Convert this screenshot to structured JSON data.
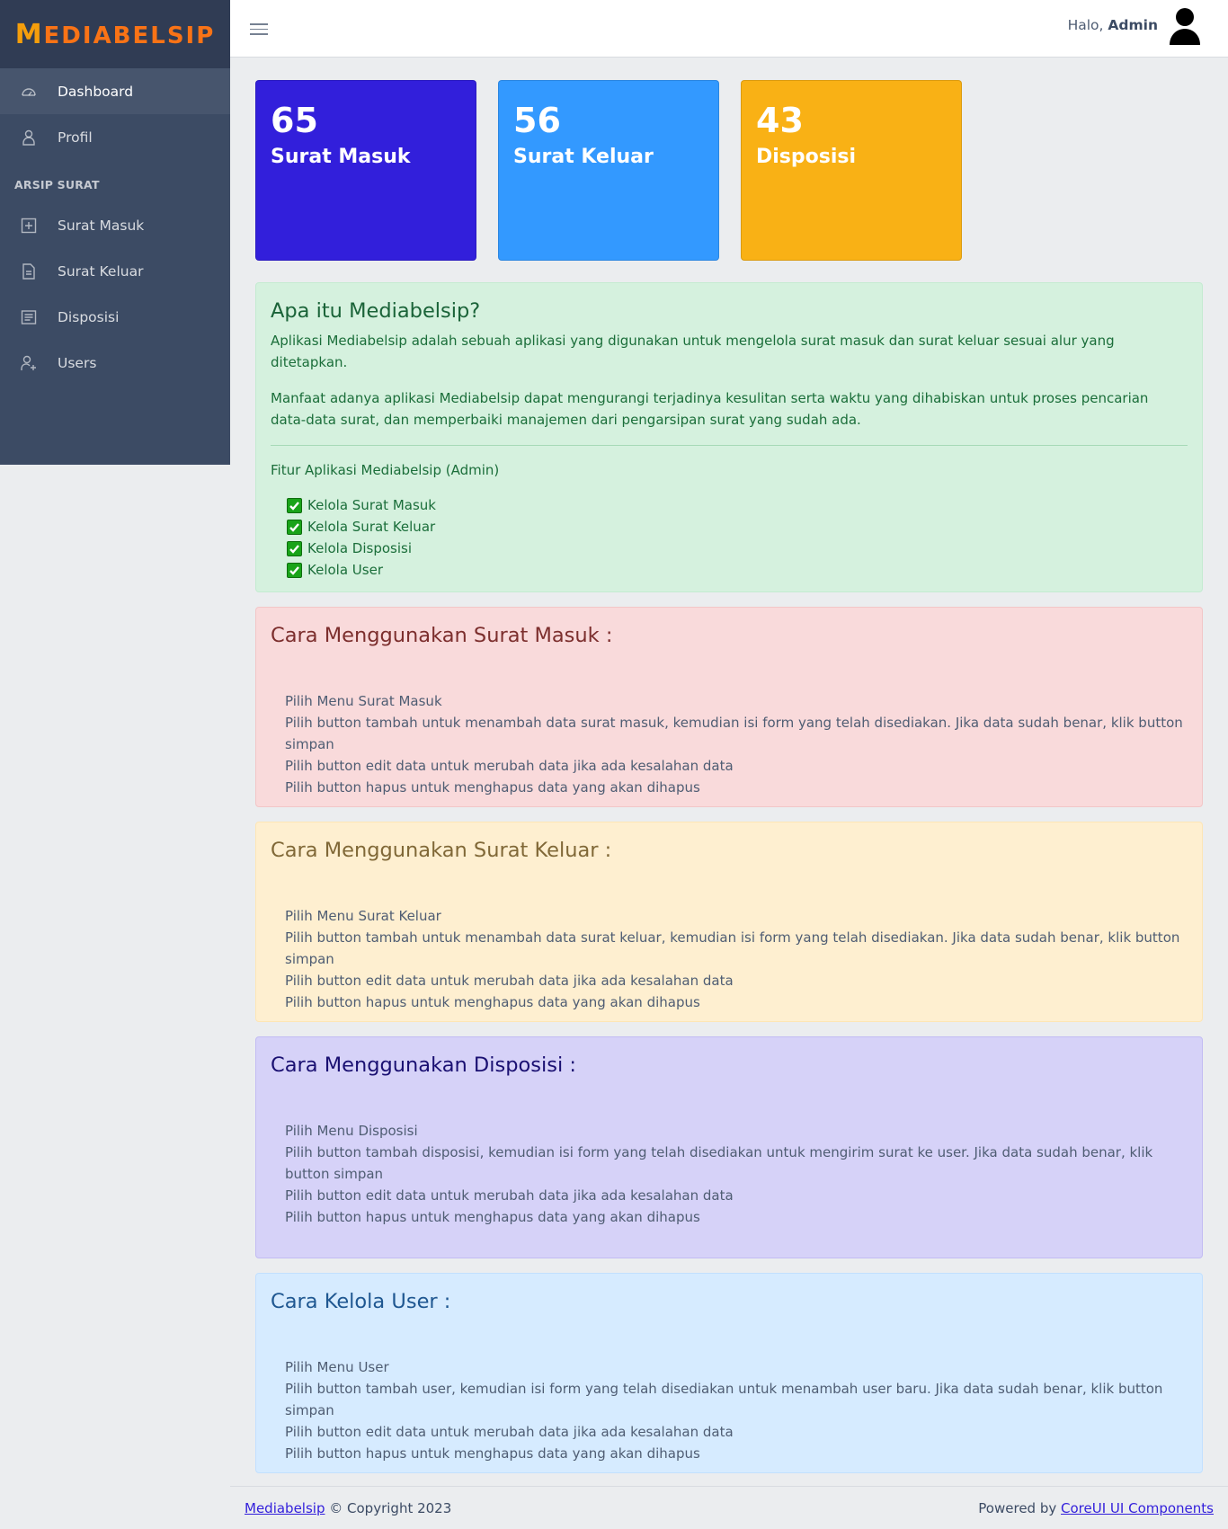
{
  "brand": {
    "logo_m": "M",
    "logo_rest": "EDIABELSIP"
  },
  "sidebar": {
    "items": [
      {
        "label": "Dashboard",
        "icon": "speedometer-icon"
      },
      {
        "label": "Profil",
        "icon": "user-icon"
      }
    ],
    "section_title": "ARSIP SURAT",
    "archive_items": [
      {
        "label": "Surat Masuk",
        "icon": "note-add-icon"
      },
      {
        "label": "Surat Keluar",
        "icon": "file-icon"
      },
      {
        "label": "Disposisi",
        "icon": "notes-icon"
      },
      {
        "label": "Users",
        "icon": "user-plus-icon"
      }
    ]
  },
  "header": {
    "greeting": "Halo,",
    "user": "Admin"
  },
  "stats": [
    {
      "value": "65",
      "label": "Surat Masuk",
      "color": "#321fdb"
    },
    {
      "value": "56",
      "label": "Surat Keluar",
      "color": "#3399ff"
    },
    {
      "value": "43",
      "label": "Disposisi",
      "color": "#f9b115"
    }
  ],
  "about": {
    "title": "Apa itu Mediabelsip?",
    "p1": "Aplikasi Mediabelsip adalah sebuah aplikasi yang digunakan untuk mengelola surat masuk dan surat keluar sesuai alur yang ditetapkan.",
    "p2": "Manfaat adanya aplikasi Mediabelsip dapat mengurangi terjadinya kesulitan serta waktu yang dihabiskan untuk proses pencarian data-data surat, dan memperbaiki manajemen dari pengarsipan surat yang sudah ada.",
    "features_title": "Fitur Aplikasi Mediabelsip (Admin)",
    "features": [
      "Kelola Surat Masuk",
      "Kelola Surat Keluar",
      "Kelola Disposisi",
      "Kelola User"
    ]
  },
  "guides": {
    "surat_masuk": {
      "title": "Cara Menggunakan Surat Masuk :",
      "steps": [
        "Pilih Menu Surat Masuk",
        "Pilih button tambah untuk menambah data surat masuk, kemudian isi form yang telah disediakan. Jika data sudah benar, klik button simpan",
        "Pilih button edit data untuk merubah data jika ada kesalahan data",
        "Pilih button hapus untuk menghapus data yang akan dihapus"
      ]
    },
    "surat_keluar": {
      "title": "Cara Menggunakan Surat Keluar :",
      "steps": [
        "Pilih Menu Surat Keluar",
        "Pilih button tambah untuk menambah data surat keluar, kemudian isi form yang telah disediakan. Jika data sudah benar, klik button simpan",
        "Pilih button edit data untuk merubah data jika ada kesalahan data",
        "Pilih button hapus untuk menghapus data yang akan dihapus"
      ]
    },
    "disposisi": {
      "title": "Cara Menggunakan Disposisi :",
      "steps": [
        "Pilih Menu Disposisi",
        "Pilih button tambah disposisi, kemudian isi form yang telah disediakan untuk mengirim surat ke user. Jika data sudah benar, klik button simpan",
        "Pilih button edit data untuk merubah data jika ada kesalahan data",
        "Pilih button hapus untuk menghapus data yang akan dihapus"
      ]
    },
    "user": {
      "title": "Cara Kelola User :",
      "steps": [
        "Pilih Menu User",
        "Pilih button tambah user, kemudian isi form yang telah disediakan untuk menambah user baru. Jika data sudah benar, klik button simpan",
        "Pilih button edit data untuk merubah data jika ada kesalahan data",
        "Pilih button hapus untuk menghapus data yang akan dihapus"
      ]
    }
  },
  "footer": {
    "brand_link": "Mediabelsip",
    "copyright": "© Copyright 2023",
    "powered_by": "Powered by",
    "powered_link": "CoreUI UI Components"
  }
}
